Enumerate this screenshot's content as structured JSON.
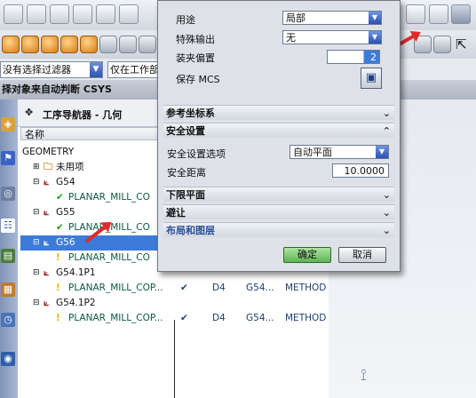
{
  "csys_bar": "择对象来自动判断 CSYS",
  "filters": {
    "type_filter": "没有选择过滤器",
    "scope_filter": "仅在工作部"
  },
  "navigator": {
    "title": "工序导航器 - 几何",
    "column_name": "名称",
    "rows": [
      {
        "label": "GEOMETRY",
        "indent": 0,
        "icon": "none"
      },
      {
        "label": "未用项",
        "indent": 1,
        "icon": "folder-icon",
        "expander": "⊞"
      },
      {
        "label": "G54",
        "indent": 1,
        "icon": "csys-icon",
        "expander": "⊟"
      },
      {
        "label": "PLANAR_MILL_CO",
        "indent": 2,
        "icon": "check-op-icon"
      },
      {
        "label": "G55",
        "indent": 1,
        "icon": "csys-icon",
        "expander": "⊟"
      },
      {
        "label": "PLANAR_MILL_CO",
        "indent": 2,
        "icon": "check-op-icon"
      },
      {
        "label": "G56",
        "indent": 1,
        "icon": "csys-icon",
        "expander": "⊟",
        "selected": true
      },
      {
        "label": "PLANAR_MILL_CO",
        "indent": 2,
        "icon": "warn-op-icon"
      },
      {
        "label": "G54.1P1",
        "indent": 1,
        "icon": "csys-icon",
        "expander": "⊟"
      },
      {
        "label": "PLANAR_MILL_COP...",
        "indent": 2,
        "icon": "warn-op-icon",
        "status": "✔",
        "tool": "D4",
        "geometry": "G54...",
        "method": "METHOD"
      },
      {
        "label": "G54.1P2",
        "indent": 1,
        "icon": "csys-icon",
        "expander": "⊟"
      },
      {
        "label": "PLANAR_MILL_COP...",
        "indent": 2,
        "icon": "warn-op-icon",
        "status": "✔",
        "tool": "D4",
        "geometry": "G54...",
        "method": "METHOD"
      }
    ]
  },
  "dialog": {
    "purpose_label": "用途",
    "purpose_value": "局部",
    "special_output_label": "特殊输出",
    "special_output_value": "无",
    "fixture_offset_label": "装夹偏置",
    "fixture_offset_value": "2",
    "save_mcs_label": "保存 MCS",
    "sections": {
      "ref_csys": "参考坐标系",
      "safety": "安全设置",
      "lower_plane": "下限平面",
      "avoidance": "避让",
      "layout_layers": "布局和图层"
    },
    "safety_option_label": "安全设置选项",
    "safety_option_value": "自动平面",
    "safety_distance_label": "安全距离",
    "safety_distance_value": "10.0000",
    "ok_label": "确定",
    "cancel_label": "取消"
  },
  "colors": {
    "selection": "#3d7bd9",
    "arrow_red": "#e02a2a",
    "ok_green": "#5eb454"
  }
}
